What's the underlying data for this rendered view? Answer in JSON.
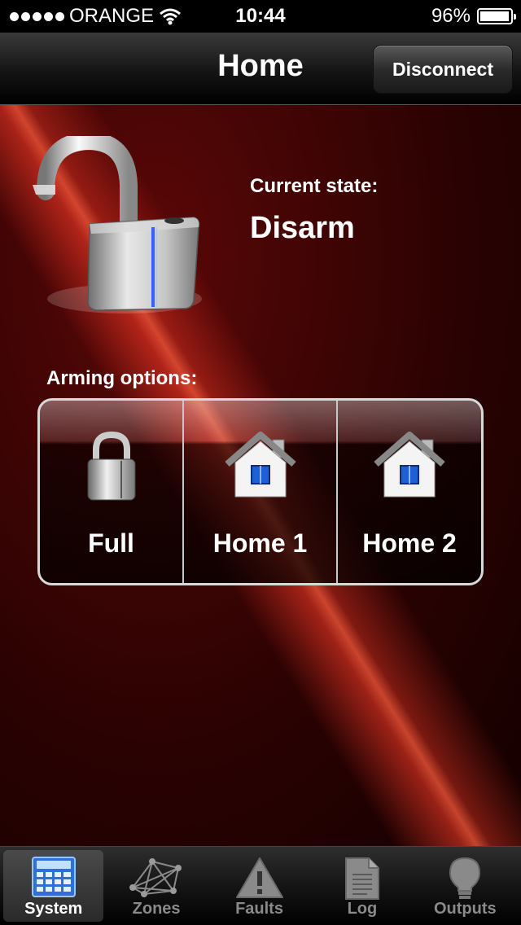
{
  "status_bar": {
    "carrier": "ORANGE",
    "time": "10:44",
    "battery": "96%",
    "battery_level": 0.96
  },
  "nav": {
    "title": "Home",
    "disconnect_label": "Disconnect"
  },
  "state": {
    "label": "Current state:",
    "value": "Disarm"
  },
  "arming": {
    "label": "Arming options:",
    "options": [
      {
        "label": "Full",
        "icon": "padlock-icon"
      },
      {
        "label": "Home 1",
        "icon": "house-icon"
      },
      {
        "label": "Home 2",
        "icon": "house-icon"
      }
    ]
  },
  "tabs": [
    {
      "label": "System",
      "icon": "calculator-icon",
      "active": true
    },
    {
      "label": "Zones",
      "icon": "network-icon",
      "active": false
    },
    {
      "label": "Faults",
      "icon": "warning-icon",
      "active": false
    },
    {
      "label": "Log",
      "icon": "document-icon",
      "active": false
    },
    {
      "label": "Outputs",
      "icon": "lightbulb-icon",
      "active": false
    }
  ]
}
